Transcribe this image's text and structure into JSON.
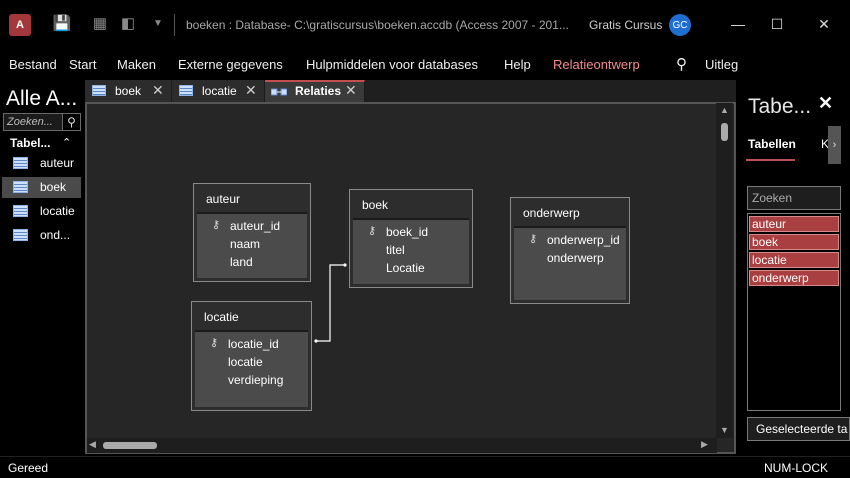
{
  "titlebar": {
    "app_icon_letter": "A",
    "window_title": "boeken : Database- C:\\gratiscursus\\boeken.accdb (Access 2007 - 201...",
    "user_name": "Gratis Cursus",
    "user_initials": "GC",
    "quick_access_icons": [
      "save-icon",
      "table-view-icon",
      "design-view-icon",
      "customize-dropdown-icon"
    ],
    "window_controls": [
      "minimize-icon",
      "maximize-icon",
      "close-icon"
    ]
  },
  "menu": {
    "items": [
      "Bestand",
      "Start",
      "Maken",
      "Externe gegevens",
      "Hulpmiddelen voor databases",
      "Help",
      "Relatieontwerp"
    ],
    "search_icon": "search-icon",
    "help_label": "Uitleg",
    "active_color": "#f28c8c"
  },
  "navpane": {
    "title": "Alle A...",
    "search_placeholder": "Zoeken...",
    "group_label": "Tabel...",
    "items": [
      "auteur",
      "boek",
      "locatie",
      "ond..."
    ],
    "selected": "boek"
  },
  "tabs": [
    {
      "label": "boek",
      "active": false
    },
    {
      "label": "locatie",
      "active": false
    },
    {
      "label": "Relaties",
      "active": true
    }
  ],
  "relationships": {
    "tables": [
      {
        "name": "auteur",
        "fields": [
          {
            "name": "auteur_id",
            "key": true
          },
          {
            "name": "naam",
            "key": false
          },
          {
            "name": "land",
            "key": false
          }
        ]
      },
      {
        "name": "boek",
        "fields": [
          {
            "name": "boek_id",
            "key": true
          },
          {
            "name": "titel",
            "key": false
          },
          {
            "name": "Locatie",
            "key": false
          }
        ]
      },
      {
        "name": "onderwerp",
        "fields": [
          {
            "name": "onderwerp_id",
            "key": true
          },
          {
            "name": "onderwerp",
            "key": false
          }
        ]
      },
      {
        "name": "locatie",
        "fields": [
          {
            "name": "locatie_id",
            "key": true
          },
          {
            "name": "locatie",
            "key": false
          },
          {
            "name": "verdieping",
            "key": false
          }
        ]
      }
    ],
    "links": [
      {
        "from": "locatie.locatie_id",
        "to": "boek.Locatie"
      }
    ]
  },
  "rightpane": {
    "title": "Tabe...",
    "tab_active": "Tabellen",
    "tab_other": "K",
    "search_placeholder": "Zoeken",
    "items": [
      "auteur",
      "boek",
      "locatie",
      "onderwerp"
    ],
    "button_label": "Geselecteerde ta",
    "accent_color": "#a93f40"
  },
  "status": {
    "left": "Gereed",
    "right": "NUM-LOCK"
  }
}
